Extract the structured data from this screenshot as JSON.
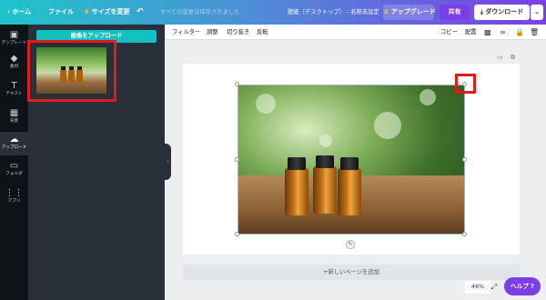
{
  "topbar": {
    "home": "ホーム",
    "file": "ファイル",
    "resize": "サイズを変更",
    "saved_status": "すべての変更は保存されました",
    "doc_title": "壁紙（デスクトップ） - 名称未設定",
    "upgrade": "アップグレード",
    "share": "共有",
    "download": "ダウンロード"
  },
  "rail": {
    "items": [
      {
        "label": "テンプレート",
        "icon": "template-icon"
      },
      {
        "label": "素材",
        "icon": "elements-icon"
      },
      {
        "label": "テキスト",
        "icon": "text-icon"
      },
      {
        "label": "背景",
        "icon": "background-icon"
      },
      {
        "label": "アップロード",
        "icon": "upload-icon"
      },
      {
        "label": "フォルダ",
        "icon": "folder-icon"
      },
      {
        "label": "アプリ",
        "icon": "apps-icon"
      }
    ]
  },
  "panel": {
    "upload_button": "画像をアップロード"
  },
  "edit_toolbar": {
    "filter": "フィルター",
    "adjust": "調整",
    "crop": "切り抜き",
    "flip": "反転",
    "copy": "コピー",
    "arrange": "配置"
  },
  "canvas": {
    "add_page": "+新しいページを追加"
  },
  "footer": {
    "zoom": "46%",
    "help": "ヘルプ ?"
  },
  "colors": {
    "accent": "#7c3ee6",
    "teal": "#13c1c3",
    "highlight": "#e11a1a"
  }
}
